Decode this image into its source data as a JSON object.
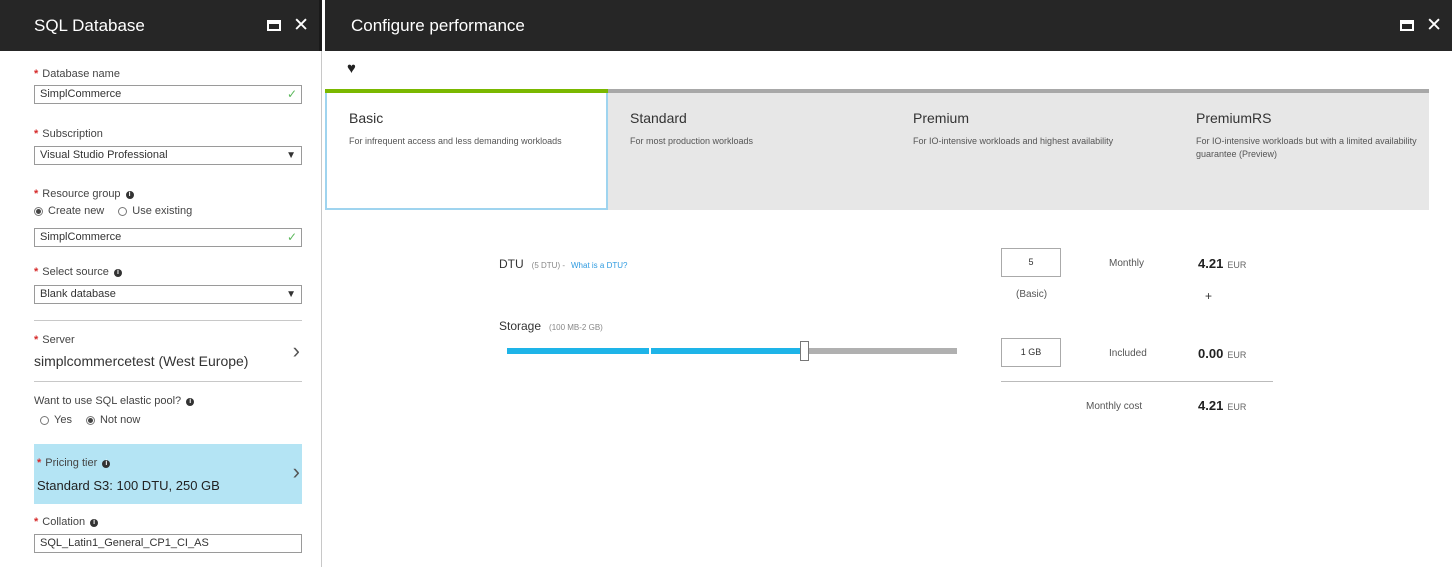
{
  "left": {
    "title": "SQL Database",
    "db_name_label": "Database name",
    "db_name_value": "SimplCommerce",
    "subscription_label": "Subscription",
    "subscription_value": "Visual Studio Professional",
    "rg_label": "Resource group",
    "rg_create_new": "Create new",
    "rg_use_existing": "Use existing",
    "rg_value": "SimplCommerce",
    "source_label": "Select source",
    "source_value": "Blank database",
    "server_label": "Server",
    "server_value": "simplcommercetest (West Europe)",
    "pool_label": "Want to use SQL elastic pool?",
    "pool_yes": "Yes",
    "pool_no": "Not now",
    "pricing_label": "Pricing tier",
    "pricing_value": "Standard S3: 100 DTU, 250 GB",
    "collation_label": "Collation",
    "collation_value": "SQL_Latin1_General_CP1_CI_AS",
    "req_mark": "*",
    "info_mark": "i"
  },
  "right": {
    "title": "Configure performance",
    "tiers": [
      {
        "name": "Basic",
        "desc": "For infrequent access and less demanding workloads"
      },
      {
        "name": "Standard",
        "desc": "For most production workloads"
      },
      {
        "name": "Premium",
        "desc": "For IO-intensive workloads and highest availability"
      },
      {
        "name": "PremiumRS",
        "desc": "For IO-intensive workloads but with a limited availability guarantee (Preview)"
      }
    ],
    "dtu_label": "DTU",
    "dtu_sub": "(5 DTU) -",
    "dtu_link": "What is a DTU?",
    "storage_label": "Storage",
    "storage_sub": "(100 MB-2 GB)",
    "storage_level_percent": 66,
    "dtu_value": "5",
    "dtu_tier": "(Basic)",
    "storage_value": "1 GB",
    "monthly_label": "Monthly",
    "monthly_price": "4.21",
    "included_label": "Included",
    "included_price": "0.00",
    "cost_label": "Monthly cost",
    "cost_price": "4.21",
    "currency": "EUR",
    "plus": "+"
  },
  "colors": {
    "header_bg": "#262626",
    "accent_green": "#7ab800",
    "slider_blue": "#1eb4e8",
    "selected_blue": "#b4e4f4",
    "link_blue": "#2f9be0",
    "required_red": "#d62b2b"
  }
}
